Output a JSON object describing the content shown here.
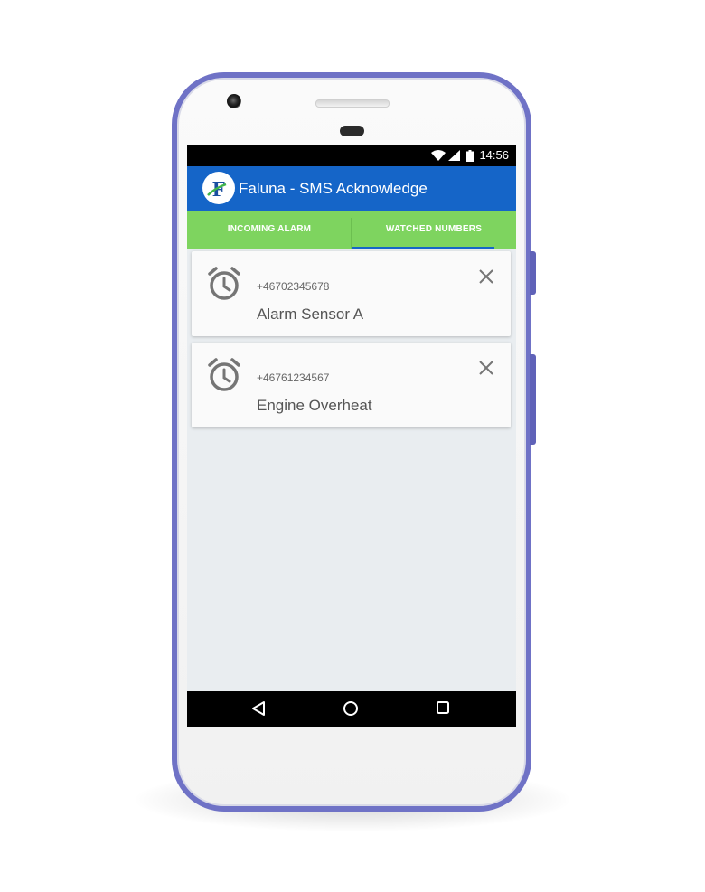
{
  "status_bar": {
    "time": "14:56",
    "icons": [
      "wifi-icon",
      "signal-icon",
      "battery-icon"
    ]
  },
  "app_bar": {
    "title": "Faluna - SMS Acknowledge",
    "logo_letter": "F",
    "color": "#1565c8"
  },
  "tabs": {
    "items": [
      {
        "label": "INCOMING ALARM",
        "selected": false
      },
      {
        "label": "WATCHED NUMBERS",
        "selected": true
      }
    ],
    "background": "#7ed45f",
    "indicator_color": "#1565c8"
  },
  "watched_numbers": [
    {
      "number": "+46702345678",
      "name": "Alarm Sensor A",
      "icon": "alarm-clock-icon",
      "action_icon": "close-icon"
    },
    {
      "number": "+46761234567",
      "name": "Engine Overheat",
      "icon": "alarm-clock-icon",
      "action_icon": "close-icon"
    }
  ],
  "fab": {
    "icon": "plus-icon",
    "color": "#1dc75a"
  },
  "nav_bar": {
    "icons": [
      "back-icon",
      "home-icon",
      "recents-icon"
    ]
  }
}
